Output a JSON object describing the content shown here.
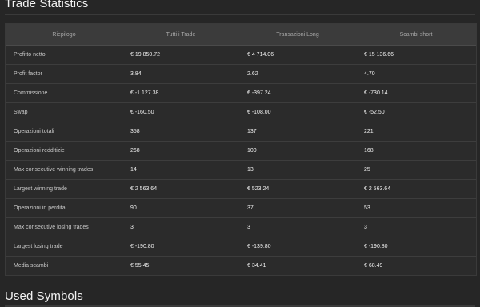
{
  "titles": {
    "trade_statistics": "Trade Statistics",
    "used_symbols": "Used Symbols"
  },
  "table": {
    "headers": [
      "Riepilogo",
      "Tutti i Trade",
      "Transazioni Long",
      "Scambi short"
    ],
    "rows": [
      {
        "label": "Profitto netto",
        "all": "€ 19 850.72",
        "long": "€ 4 714.06",
        "short": "€ 15 136.66"
      },
      {
        "label": "Profit factor",
        "all": "3.84",
        "long": "2.62",
        "short": "4.70"
      },
      {
        "label": "Commissione",
        "all": "€ -1 127.38",
        "long": "€ -397.24",
        "short": "€ -730.14"
      },
      {
        "label": "Swap",
        "all": "€ -160.50",
        "long": "€ -108.00",
        "short": "€ -52.50"
      },
      {
        "label": "Operazioni totali",
        "all": "358",
        "long": "137",
        "short": "221"
      },
      {
        "label": "Operazioni redditizie",
        "all": "268",
        "long": "100",
        "short": "168"
      },
      {
        "label": "Max consecutive winning trades",
        "all": "14",
        "long": "13",
        "short": "25"
      },
      {
        "label": "Largest winning trade",
        "all": "€ 2 563.64",
        "long": "€ 523.24",
        "short": "€ 2 563.64"
      },
      {
        "label": "Operazioni in perdita",
        "all": "90",
        "long": "37",
        "short": "53"
      },
      {
        "label": "Max consecutive losing trades",
        "all": "3",
        "long": "3",
        "short": "3"
      },
      {
        "label": "Largest losing trade",
        "all": "€ -190.80",
        "long": "€ -139.80",
        "short": "€ -190.80"
      },
      {
        "label": "Media scambi",
        "all": "€ 55.45",
        "long": "€ 34.41",
        "short": "€ 68.49"
      }
    ]
  }
}
